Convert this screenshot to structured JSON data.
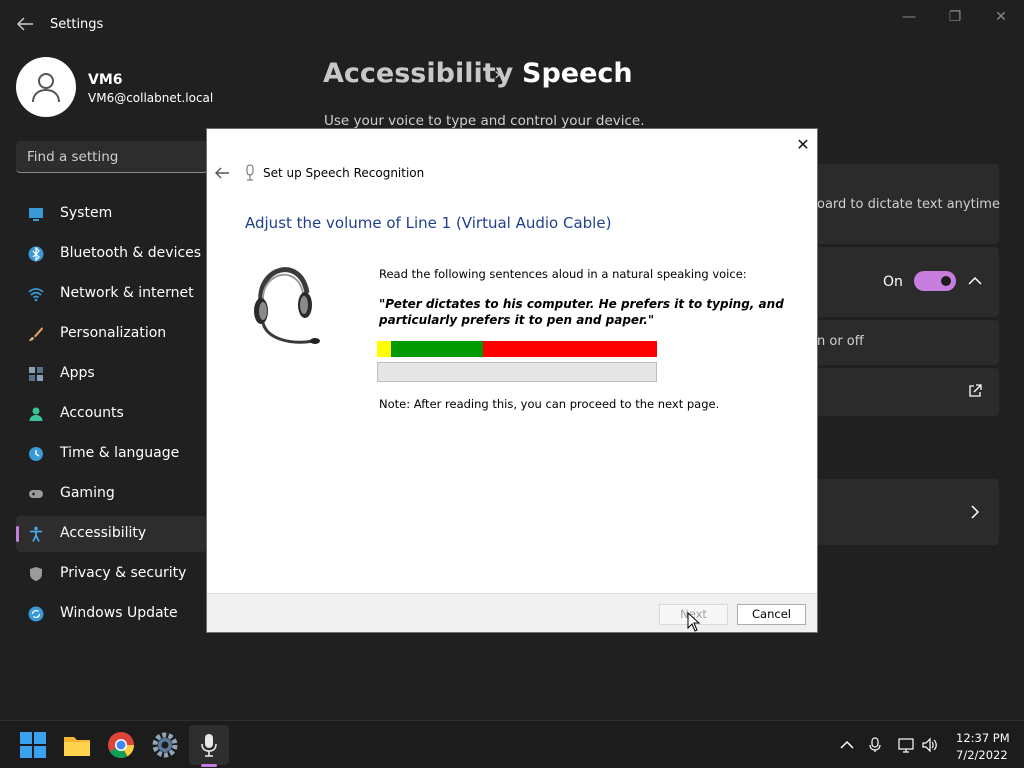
{
  "window": {
    "app_title": "Settings",
    "controls": {
      "minimize": "—",
      "maximize": "❐",
      "close": "✕"
    }
  },
  "profile": {
    "name": "VM6",
    "email": "VM6@collabnet.local"
  },
  "search": {
    "placeholder": "Find a setting"
  },
  "sidebar": {
    "items": [
      {
        "label": "System",
        "icon": "monitor-icon",
        "color": "#3a9ad9"
      },
      {
        "label": "Bluetooth & devices",
        "icon": "bluetooth-icon",
        "color": "#3a9ad9"
      },
      {
        "label": "Network & internet",
        "icon": "wifi-icon",
        "color": "#3a9ad9"
      },
      {
        "label": "Personalization",
        "icon": "brush-icon",
        "color": "#e0a060"
      },
      {
        "label": "Apps",
        "icon": "apps-icon",
        "color": "#8aa0b8"
      },
      {
        "label": "Accounts",
        "icon": "person-icon",
        "color": "#3ac29a"
      },
      {
        "label": "Time & language",
        "icon": "globe-clock-icon",
        "color": "#3a9ad9"
      },
      {
        "label": "Gaming",
        "icon": "gamepad-icon",
        "color": "#9a9a9a"
      },
      {
        "label": "Accessibility",
        "icon": "accessibility-icon",
        "color": "#4aa8e8",
        "active": true
      },
      {
        "label": "Privacy & security",
        "icon": "shield-icon",
        "color": "#9a9a9a"
      },
      {
        "label": "Windows Update",
        "icon": "update-icon",
        "color": "#3a9ad9"
      }
    ]
  },
  "header": {
    "breadcrumb_parent": "Accessibility",
    "breadcrumb_sep": "›",
    "breadcrumb_current": "Speech",
    "description": "Use your voice to type and control your device."
  },
  "cards": {
    "dictate_text": "oard to dictate text anytime",
    "toggle_label": "On",
    "toggle_state": "on",
    "onoff_text": "n or off"
  },
  "dialog": {
    "nav_title": "Set up Speech Recognition",
    "heading": "Adjust the volume of Line 1 (Virtual Audio Cable)",
    "instruction": "Read the following sentences aloud in a natural speaking voice:",
    "quote": "\"Peter dictates to his computer. He prefers it to typing, and particularly prefers it to pen and paper.\"",
    "note": "Note: After reading this, you can proceed to the next page.",
    "meter_segments": [
      {
        "color": "#ffff00",
        "fraction": 0.05
      },
      {
        "color": "#009900",
        "fraction": 0.33
      },
      {
        "color": "#ff0000",
        "fraction": 0.62
      }
    ],
    "volume_level": 0,
    "next_label": "Next",
    "cancel_label": "Cancel",
    "close_glyph": "✕"
  },
  "taskbar": {
    "apps": [
      "start-icon",
      "file-explorer-icon",
      "chrome-icon",
      "settings-icon",
      "speech-recognition-icon"
    ],
    "clock_time": "12:37 PM",
    "clock_date": "7/2/2022"
  },
  "colors": {
    "accent": "#c77dde",
    "background": "#202020",
    "card": "#2b2b2b",
    "dialog_heading": "#1f3f8f"
  }
}
